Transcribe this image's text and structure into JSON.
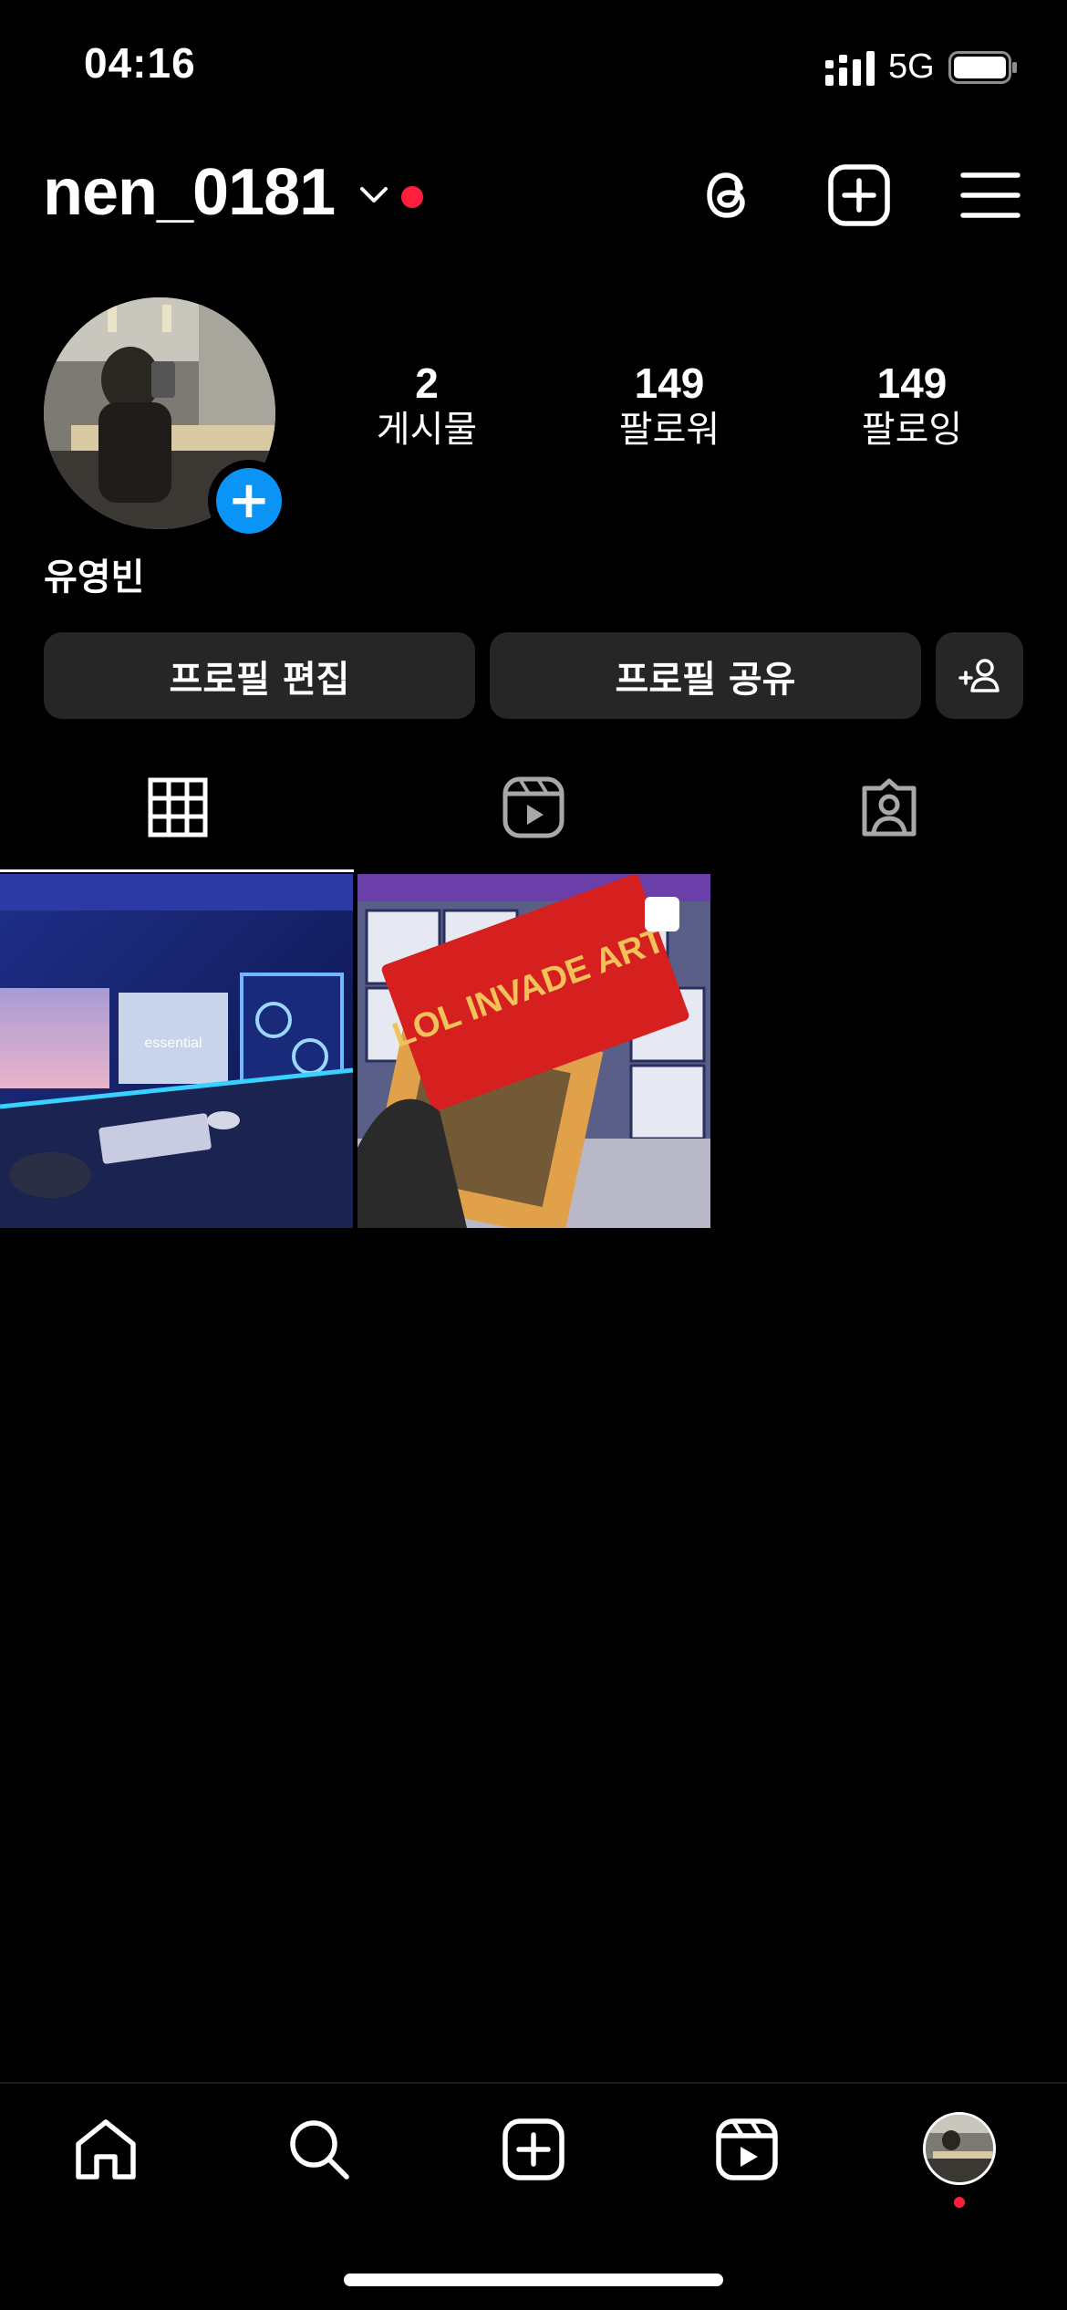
{
  "status": {
    "time": "04:16",
    "network": "5G"
  },
  "header": {
    "username": "nen_0181"
  },
  "profile": {
    "full_name": "유영빈",
    "stats": [
      {
        "value": "2",
        "label": "게시물"
      },
      {
        "value": "149",
        "label": "팔로워"
      },
      {
        "value": "149",
        "label": "팔로잉"
      }
    ]
  },
  "buttons": {
    "edit_profile": "프로필 편집",
    "share_profile": "프로필 공유"
  },
  "colors": {
    "accent_blue": "#0a95f6",
    "notification_red": "#ff1f3d",
    "button_bg": "#262626"
  },
  "icons": {
    "header": [
      "chevron-down-icon",
      "threads-icon",
      "create-post-icon",
      "menu-icon"
    ],
    "tabs": [
      "grid-icon",
      "reels-icon",
      "tagged-icon"
    ],
    "nav": [
      "home-icon",
      "search-icon",
      "create-icon",
      "reels-icon",
      "profile-avatar"
    ]
  },
  "posts": [
    {
      "embedded_text": "essential"
    },
    {
      "embedded_text": "LOL INVADE ART"
    }
  ]
}
